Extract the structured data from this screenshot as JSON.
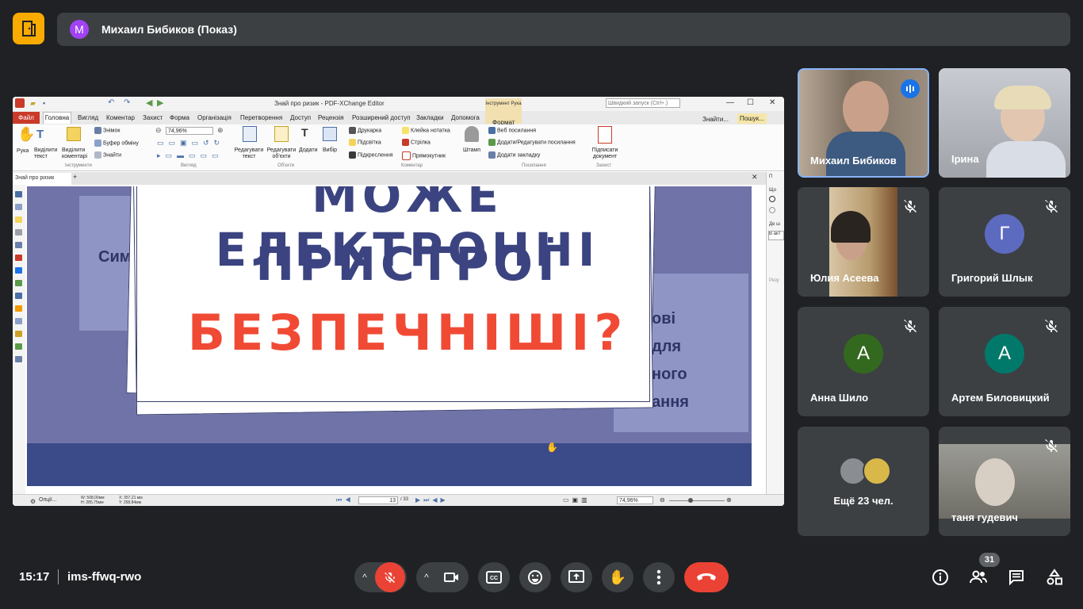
{
  "presenter": {
    "avatar_letter": "М",
    "label": "Михаил Бибиков (Показ)"
  },
  "pdf": {
    "title": "Знай про ризик - PDF-XChange Editor",
    "quick_search": "Швидкий запуск (Ctrl+.)",
    "tabs": [
      "Файл",
      "Головна",
      "Вигляд",
      "Коментар",
      "Захист",
      "Форма",
      "Організація",
      "Перетворення",
      "Доступ",
      "Рецензія",
      "Розширений доступ",
      "Закладки",
      "Допомога",
      "Формат"
    ],
    "tool_context": "Інструмент Рука",
    "right_tabs": [
      "Знайти...",
      "Пошук..."
    ],
    "ribbon": {
      "hand": "Рука",
      "select_text": "Виділити текст",
      "select_comments": "Виділити коментарі",
      "snapshot": "Знімок",
      "clipboard": "Буфер обміну",
      "find": "Знайти",
      "zoom": "74,96%",
      "edit_text": "Редагувати текст",
      "edit_objects": "Редагувати об'єкти",
      "add": "Додати",
      "select": "Вибір",
      "typewriter": "Друкарка",
      "highlight": "Підсвітка",
      "underline": "Підкреслення",
      "sticky_note": "Клейка нотатка",
      "arrow": "Стрілка",
      "rectangle": "Прямокутник",
      "stamp": "Штамп",
      "web_links": "Веб посилання",
      "add_edit_links": "Додати/Редагувати посилання",
      "add_bookmark": "Додати закладку",
      "sign_doc": "Підписати документ",
      "groups": [
        "Інструменти",
        "Вигляд",
        "Об'єкти",
        "Коментар",
        "Посилання",
        "Захист"
      ]
    },
    "doc_tab": "Знай про ризик",
    "status": {
      "options": "Опції...",
      "w": "W: 508,00мм",
      "h": "H: 285,75мм",
      "x": "X: 357,21 мм",
      "y": "Y: 258,84мм",
      "page": "13",
      "page_total": "/ 33",
      "zoom": "74,96%"
    },
    "right_panel": [
      "П",
      "Що",
      "Де ш",
      "В акт",
      "Резу"
    ]
  },
  "slide": {
    "line1": "МОЖЕ ЕЛЕКТРОННІ",
    "line2": "ПРИСТРОЇ",
    "line3": "БЕЗПЕЧНІШІ?",
    "left_text": "Сим",
    "right_text": [
      "ові",
      "для",
      "ного",
      "ання"
    ]
  },
  "participants": [
    {
      "name": "Михаил Бибиков",
      "speaking": true
    },
    {
      "name": "Ірина"
    },
    {
      "name": "Юлия Асеева",
      "muted": true
    },
    {
      "name": "Григорий Шлык",
      "letter": "Г",
      "color": "#5c6bc0",
      "muted": true
    },
    {
      "name": "Анна Шило",
      "letter": "А",
      "color": "#33691e",
      "muted": true
    },
    {
      "name": "Артем Биловицкий",
      "letter": "А",
      "color": "#00796b",
      "muted": true
    },
    {
      "name": "Ещё 23 чел."
    },
    {
      "name": "таня гудевич",
      "muted": true
    }
  ],
  "footer": {
    "time": "15:17",
    "meeting_code": "ims-ffwq-rwo",
    "people_count": "31"
  },
  "colors": {
    "end_call": "#ea4335",
    "mic_off": "#ea4335",
    "speaking": "#1a73e8"
  }
}
